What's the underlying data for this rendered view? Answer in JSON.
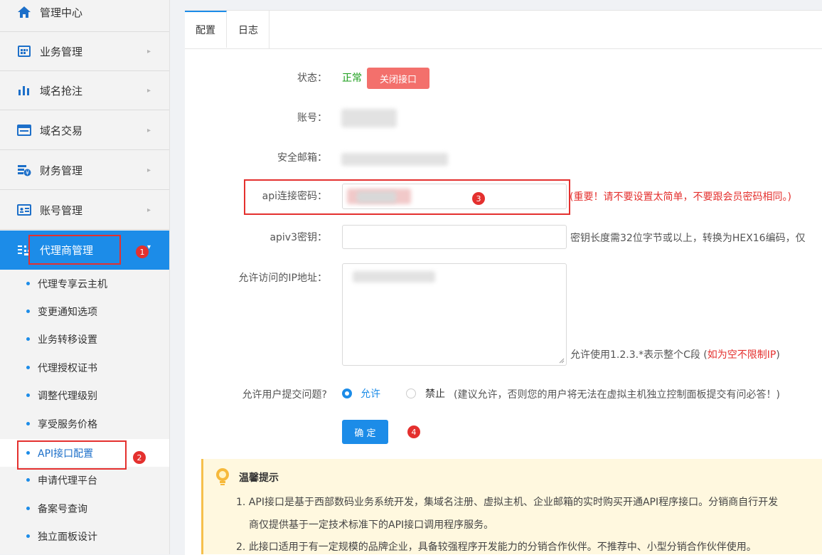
{
  "sidebar": {
    "items": [
      {
        "label": "管理中心",
        "icon": "home-icon"
      },
      {
        "label": "业务管理",
        "icon": "grid-icon"
      },
      {
        "label": "域名抢注",
        "icon": "bar-chart-icon"
      },
      {
        "label": "域名交易",
        "icon": "browser-window-icon"
      },
      {
        "label": "财务管理",
        "icon": "finance-icon"
      },
      {
        "label": "账号管理",
        "icon": "id-card-icon"
      },
      {
        "label": "代理商管理",
        "icon": "agent-icon"
      }
    ],
    "sub_items": [
      "代理专享云主机",
      "变更通知选项",
      "业务转移设置",
      "代理授权证书",
      "调整代理级别",
      "享受服务价格",
      "API接口配置",
      "申请代理平台",
      "备案号查询",
      "独立面板设计"
    ]
  },
  "tabs": [
    "配置",
    "日志"
  ],
  "form": {
    "status_label": "状态：",
    "status_value": "正常",
    "close_api_button": "关闭接口",
    "account_label": "账号：",
    "email_label": "安全邮箱：",
    "api_password_label": "api连接密码：",
    "api_password_hint": "(重要！请不要设置太简单，不要跟会员密码相同。)",
    "apiv3_label": "apiv3密钥：",
    "apiv3_hint": "密钥长度需32位字节或以上，转换为HEX16编码，仅",
    "ip_label": "允许访问的IP地址：",
    "ip_hint_prefix": "允许使用1.2.3.*表示整个C段 (",
    "ip_hint_red": "如为空不限制IP",
    "ip_hint_suffix": ")",
    "allow_question_label": "允许用户提交问题?",
    "option_allow": "允许",
    "option_deny": "禁止",
    "allow_hint": "(建议允许，否则您的用户将无法在虚拟主机独立控制面板提交有问必答！)",
    "confirm_button": "确 定"
  },
  "annotations": [
    "1",
    "2",
    "3",
    "4"
  ],
  "notice": {
    "title": "温馨提示",
    "line1": "1. API接口是基于西部数码业务系统开发，集域名注册、虚拟主机、企业邮箱的实时购买开通API程序接口。分销商自行开发",
    "line1b": "商仅提供基于一定技术标准下的API接口调用程序服务。",
    "line2": "2. 此接口适用于有一定规模的品牌企业，具备较强程序开发能力的分销合作伙伴。不推荐中、小型分销合作伙伴使用。"
  },
  "colors": {
    "accent": "#1c8ce8",
    "danger": "#e4302e",
    "success": "#1a9e1a",
    "close_button": "#f3706c",
    "notice_bg": "#fff8df"
  }
}
